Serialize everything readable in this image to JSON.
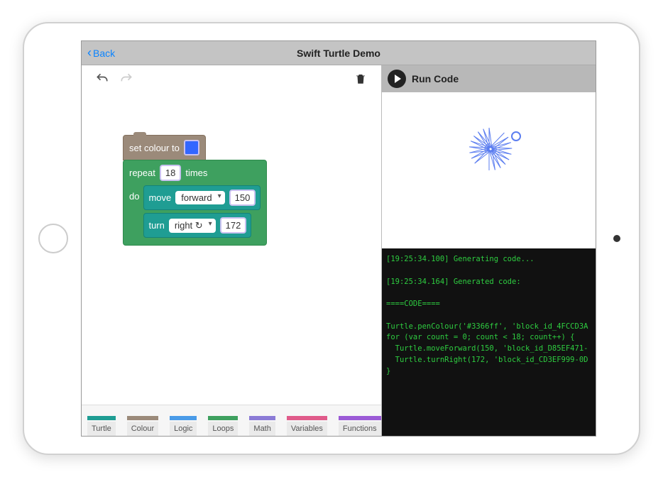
{
  "nav": {
    "back_label": "Back",
    "title": "Swift Turtle Demo"
  },
  "blocks": {
    "set_colour_label": "set colour to",
    "colour_hex": "#3366ff",
    "repeat_label": "repeat",
    "repeat_count": "18",
    "times_label": "times",
    "do_label": "do",
    "move_label": "move",
    "move_direction": "forward",
    "move_distance": "150",
    "turn_label": "turn",
    "turn_direction": "right ↻",
    "turn_angle": "172"
  },
  "categories": [
    {
      "name": "Turtle",
      "color": "#1f9d93"
    },
    {
      "name": "Colour",
      "color": "#9b8a7a"
    },
    {
      "name": "Logic",
      "color": "#4a9be8"
    },
    {
      "name": "Loops",
      "color": "#3ea05f"
    },
    {
      "name": "Math",
      "color": "#8b7bd6"
    },
    {
      "name": "Variables",
      "color": "#e05b8a"
    },
    {
      "name": "Functions",
      "color": "#9b5bd6"
    }
  ],
  "run": {
    "label": "Run Code"
  },
  "console_lines": [
    "[19:25:34.100] Generating code...",
    "",
    "[19:25:34.164] Generated code:",
    "",
    "====CODE====",
    "",
    "Turtle.penColour('#3366ff', 'block_id_4FCCD3A",
    "for (var count = 0; count < 18; count++) {",
    "  Turtle.moveForward(150, 'block_id_D85EF471-",
    "  Turtle.turnRight(172, 'block_id_CD3EF999-0D",
    "}"
  ],
  "turtle": {
    "spokes": 18,
    "angle_step": 172,
    "stroke": "#5b7df0"
  }
}
